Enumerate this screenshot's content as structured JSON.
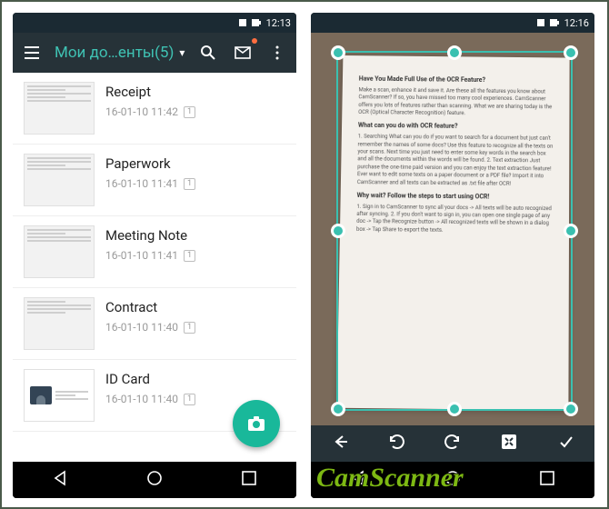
{
  "left": {
    "status_time": "12:13",
    "appbar_title": "Мои до…енты(5)",
    "docs": [
      {
        "title": "Receipt",
        "date": "16-01-10 11:42",
        "pages": "1"
      },
      {
        "title": "Paperwork",
        "date": "16-01-10 11:41",
        "pages": "1"
      },
      {
        "title": "Meeting Note",
        "date": "16-01-10 11:41",
        "pages": "1"
      },
      {
        "title": "Contract",
        "date": "16-01-10 11:40",
        "pages": "1"
      },
      {
        "title": "ID Card",
        "date": "16-01-10 11:40",
        "pages": "1"
      }
    ]
  },
  "right": {
    "status_time": "12:16",
    "paper": {
      "h1": "Have You Made Full Use of the OCR Feature?",
      "p1": "Make a scan, enhance it and save it. Are these all the features you know about CamScanner? If so, you have missed too many cool experiences. CamScanner offers you lots of features rather than scanning. What we are sharing today is the OCR (Optical Character Recognition) feature.",
      "h2": "What can you do with OCR feature?",
      "p2": "1. Searching\nWhat can you do if you want to search for a document but just can't remember the names of some docs? Use this feature to recognize all the texts on your scans. Next time you just need to enter some key words in the search box and all the documents within the words will be found.\n2. Text extraction\nJust purchase the one-time paid version and you can enjoy the text extraction feature! Ever want to edit some texts on a paper document or a PDF file? Import it into CamScanner and all texts can be extracted as .txt file after OCR!",
      "h3": "Why wait? Follow the steps to start using OCR!",
      "p3": "1. Sign in to CamScanner to sync all your docs -> All texts will be auto recognized after syncing.\n2. If you don't want to sign in, you can open one single page of any doc -> Tap the Recognize button -> All recognized texts will be shown in a dialog box -> Tap Share to export the texts."
    }
  },
  "watermark": "CamScanner"
}
